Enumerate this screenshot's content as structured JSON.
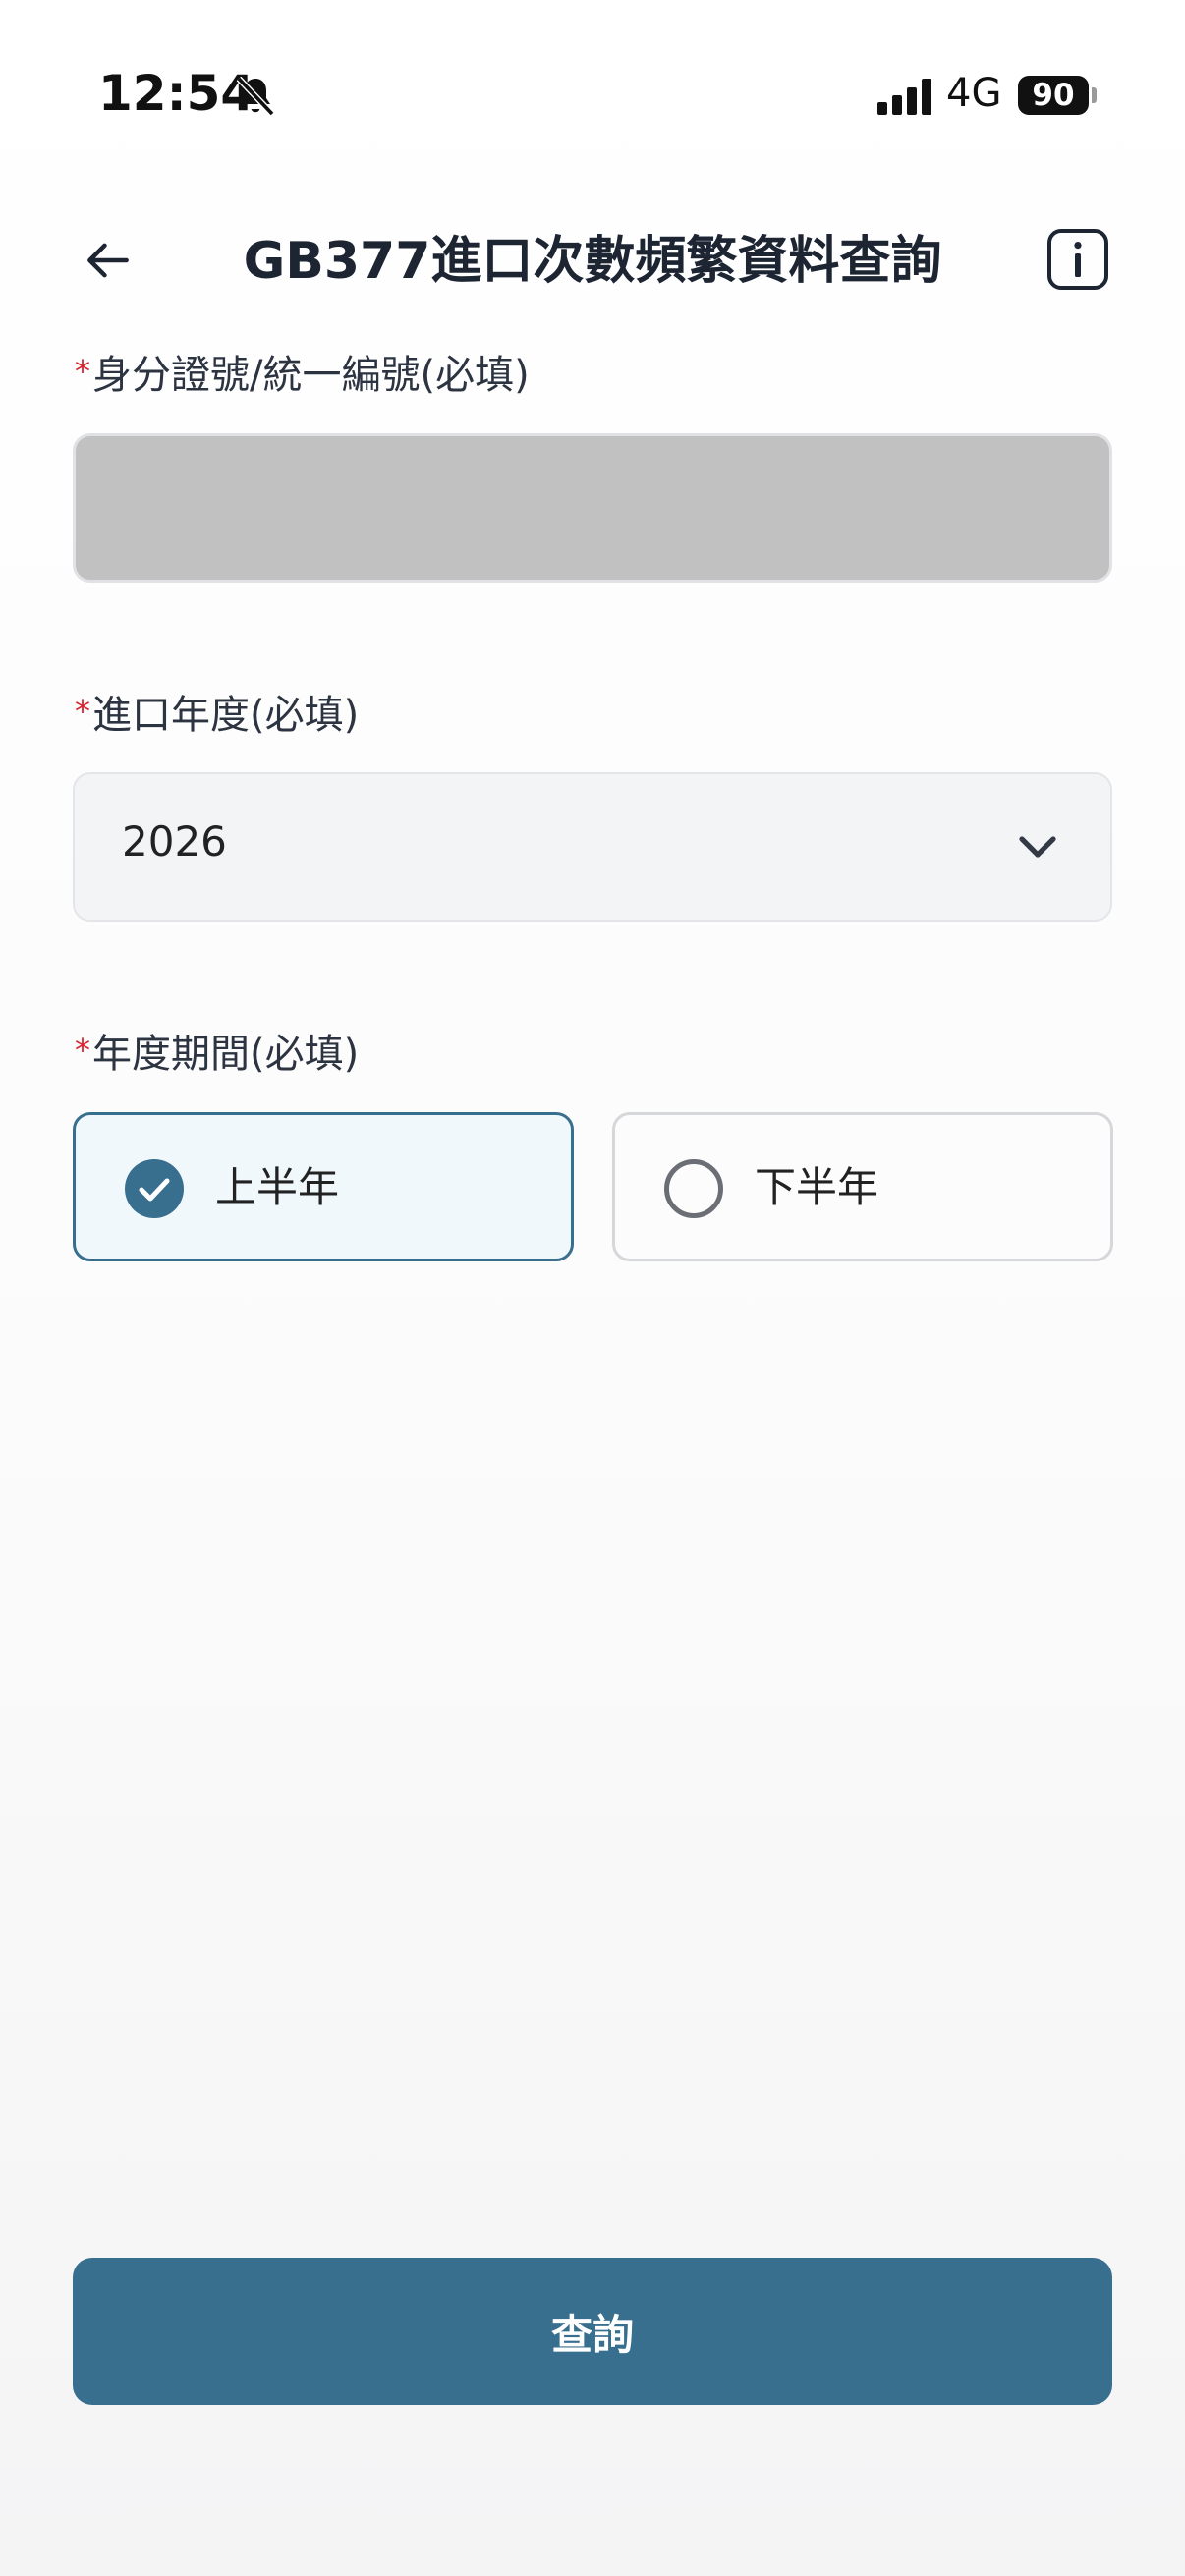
{
  "status_bar": {
    "time": "12:54",
    "network": "4G",
    "battery": "90"
  },
  "header": {
    "title": "GB377進口次數頻繁資料查詢"
  },
  "form": {
    "id_field": {
      "required_mark": "*",
      "label": "身分證號/統一編號(必填)",
      "value": ""
    },
    "year_field": {
      "required_mark": "*",
      "label": "進口年度(必填)",
      "value": "2026"
    },
    "period_field": {
      "required_mark": "*",
      "label": "年度期間(必填)",
      "options": [
        {
          "label": "上半年",
          "selected": true
        },
        {
          "label": "下半年",
          "selected": false
        }
      ]
    }
  },
  "actions": {
    "query_label": "查詢"
  },
  "colors": {
    "accent": "#386e8e",
    "required": "#d9232e"
  }
}
